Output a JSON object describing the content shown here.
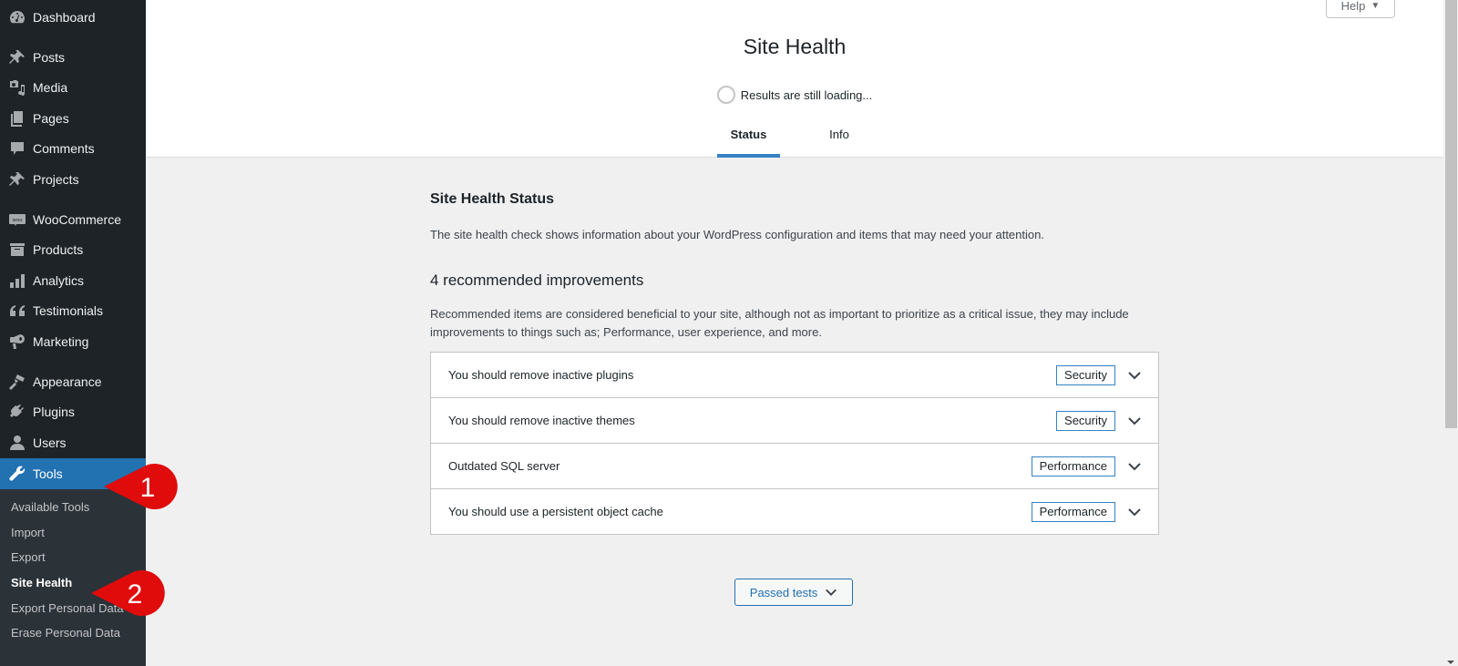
{
  "sidebar": {
    "items": [
      {
        "label": "Dashboard",
        "icon": "dashboard-icon"
      },
      {
        "label": "Posts",
        "icon": "pin-icon"
      },
      {
        "label": "Media",
        "icon": "media-icon"
      },
      {
        "label": "Pages",
        "icon": "pages-icon"
      },
      {
        "label": "Comments",
        "icon": "comment-icon"
      },
      {
        "label": "Projects",
        "icon": "pin-icon"
      },
      {
        "label": "WooCommerce",
        "icon": "woocommerce-icon"
      },
      {
        "label": "Products",
        "icon": "archive-icon"
      },
      {
        "label": "Analytics",
        "icon": "bar-chart-icon"
      },
      {
        "label": "Testimonials",
        "icon": "quote-icon"
      },
      {
        "label": "Marketing",
        "icon": "megaphone-icon"
      },
      {
        "label": "Appearance",
        "icon": "paintbrush-icon"
      },
      {
        "label": "Plugins",
        "icon": "plug-icon"
      },
      {
        "label": "Users",
        "icon": "user-icon"
      },
      {
        "label": "Tools",
        "icon": "wrench-icon",
        "active": true
      }
    ],
    "submenu": [
      {
        "label": "Available Tools"
      },
      {
        "label": "Import"
      },
      {
        "label": "Export"
      },
      {
        "label": "Site Health",
        "current": true
      },
      {
        "label": "Export Personal Data"
      },
      {
        "label": "Erase Personal Data"
      }
    ]
  },
  "annotations": [
    {
      "number": "1",
      "target": "Tools"
    },
    {
      "number": "2",
      "target": "Site Health"
    }
  ],
  "header": {
    "title": "Site Health",
    "loading_text": "Results are still loading...",
    "help_label": "Help",
    "tabs": [
      {
        "label": "Status",
        "active": true
      },
      {
        "label": "Info",
        "active": false
      }
    ]
  },
  "main": {
    "status_title": "Site Health Status",
    "status_description": "The site health check shows information about your WordPress configuration and items that may need your attention.",
    "improvements_title": "4 recommended improvements",
    "improvements_description": "Recommended items are considered beneficial to your site, although not as important to prioritize as a critical issue, they may include improvements to things such as; Performance, user experience, and more.",
    "issues": [
      {
        "title": "You should remove inactive plugins",
        "badge": "Security"
      },
      {
        "title": "You should remove inactive themes",
        "badge": "Security"
      },
      {
        "title": "Outdated SQL server",
        "badge": "Performance"
      },
      {
        "title": "You should use a persistent object cache",
        "badge": "Performance"
      }
    ],
    "passed_tests_label": "Passed tests"
  },
  "colors": {
    "sidebar_bg": "#1d2327",
    "submenu_bg": "#2c3338",
    "accent": "#2271b1",
    "badge_border": "#3582c4",
    "annotation_red": "#e00b0b"
  }
}
